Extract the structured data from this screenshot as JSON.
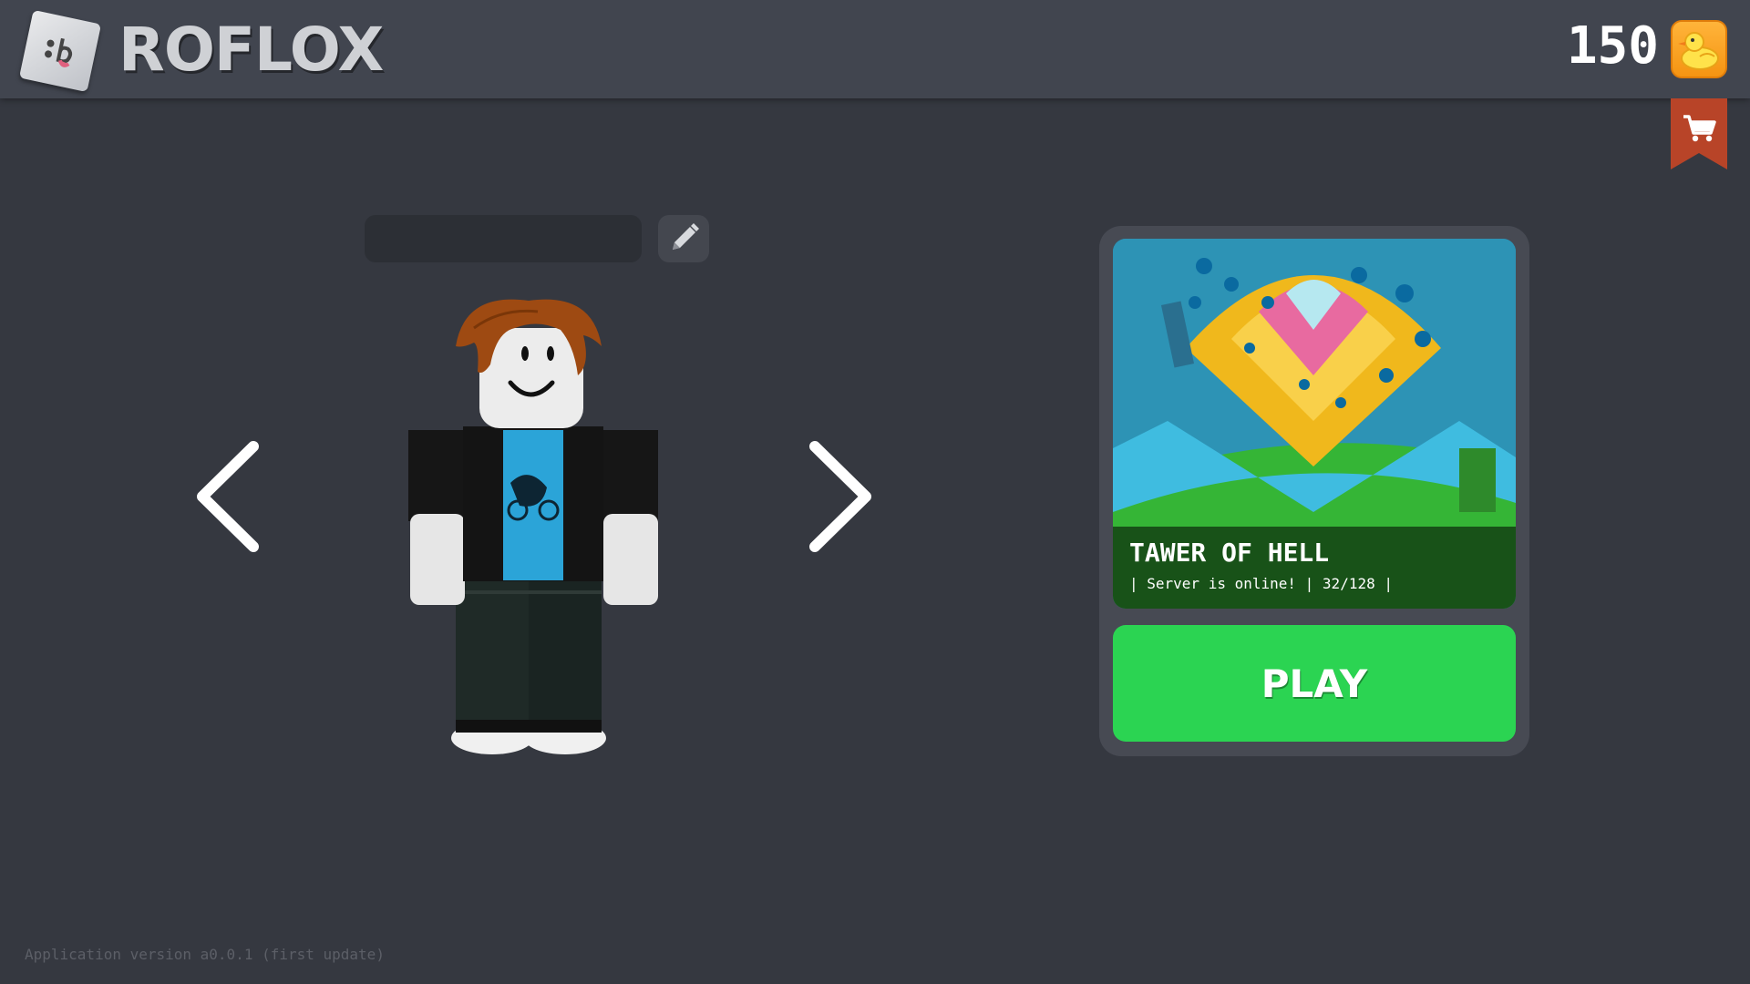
{
  "header": {
    "brand": "ROFLOX",
    "currency_amount": "150",
    "currency_icon": "duck-icon",
    "cart_icon": "shopping-cart-icon"
  },
  "avatar_panel": {
    "name_input_value": "",
    "name_input_placeholder": "",
    "edit_icon": "pencil-icon",
    "prev_icon": "chevron-left-icon",
    "next_icon": "chevron-right-icon"
  },
  "game_card": {
    "title": "TAWER OF HELL",
    "status": "| Server is online! | 32/128 |",
    "play_label": "PLAY"
  },
  "footer": {
    "version": "Application version a0.0.1 (first update)"
  },
  "colors": {
    "background": "#353840",
    "header": "#41454f",
    "play_button": "#2bd452",
    "coin_badge": "#f59412",
    "cart_ribbon": "#b84428"
  }
}
